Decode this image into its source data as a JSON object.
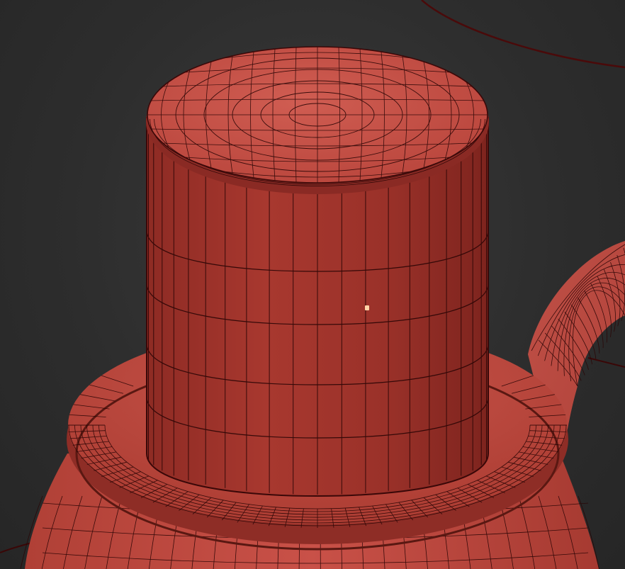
{
  "viewport": {
    "background_color": "#2b2b2b"
  },
  "mesh": {
    "material_color": "#b8443c",
    "shadow_color": "#8a2a25",
    "highlight_color": "#cf5a50",
    "wire_color": "#2a0505"
  },
  "selection_marker": {
    "color": "#ffd4a8"
  }
}
